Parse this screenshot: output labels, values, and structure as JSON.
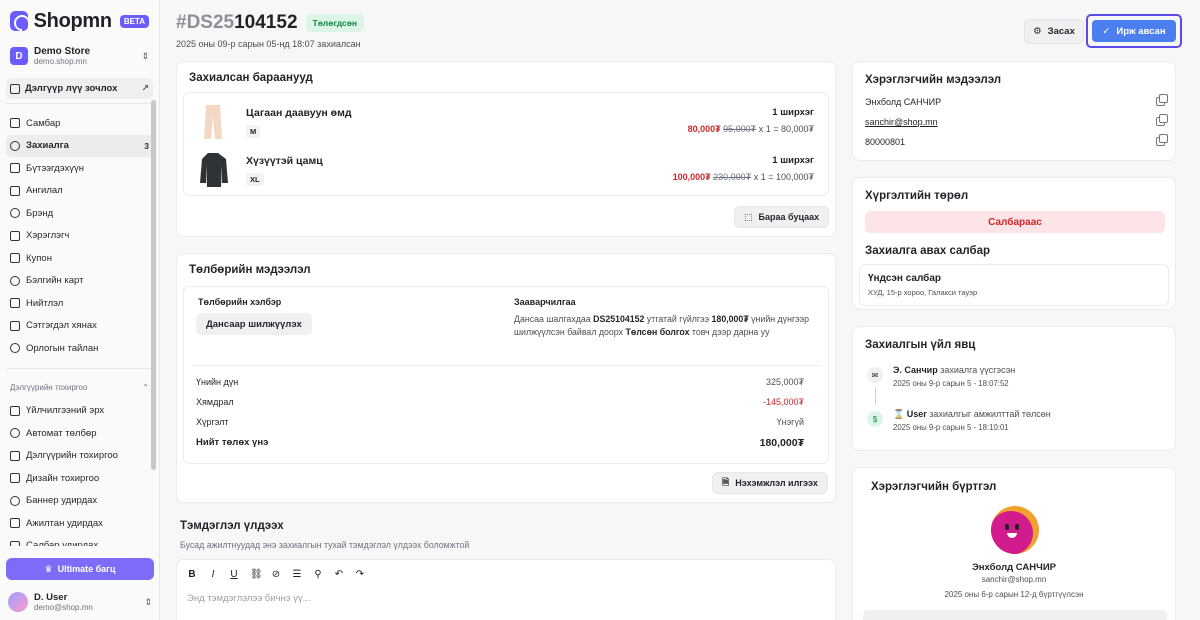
{
  "sidebar": {
    "logo_text": "Shopmn",
    "beta": "BETA",
    "store": {
      "initial": "D",
      "name": "Demo Store",
      "domain": "demo.shop.mn"
    },
    "visit_label": "Дэлгүүр лүү зочлох",
    "items": [
      {
        "label": "Самбар",
        "icon": "home-icon"
      },
      {
        "label": "Захиалга",
        "icon": "inbox-icon",
        "count": "3"
      },
      {
        "label": "Бүтээгдэхүүн",
        "icon": "package-icon"
      },
      {
        "label": "Ангилал",
        "icon": "category-icon"
      },
      {
        "label": "Брэнд",
        "icon": "tag-icon"
      },
      {
        "label": "Хэрэглэгч",
        "icon": "users-icon"
      },
      {
        "label": "Купон",
        "icon": "ticket-icon"
      },
      {
        "label": "Бэлгийн карт",
        "icon": "gift-card-icon"
      },
      {
        "label": "Нийтлэл",
        "icon": "article-icon"
      },
      {
        "label": "Сэтгэгдэл хянах",
        "icon": "comment-icon"
      },
      {
        "label": "Орлогын тайлан",
        "icon": "report-icon"
      }
    ],
    "section_label": "Дэлгүүрийн тохиргоо",
    "settings_items": [
      {
        "label": "Үйлчилгээний эрх",
        "icon": "license-icon"
      },
      {
        "label": "Автомат төлбөр",
        "icon": "autopay-icon"
      },
      {
        "label": "Дэлгүүрийн тохиргоо",
        "icon": "settings-icon"
      },
      {
        "label": "Дизайн тохиргоо",
        "icon": "brush-icon"
      },
      {
        "label": "Баннер удирдах",
        "icon": "banner-icon"
      },
      {
        "label": "Ажилтан удирдах",
        "icon": "staff-icon"
      },
      {
        "label": "Салбар удирдах",
        "icon": "branch-icon"
      }
    ],
    "ultimate_label": "Ultimate багц",
    "user": {
      "name": "D. User",
      "email": "demo@shop.mn"
    }
  },
  "header": {
    "hash": "#DS25",
    "order_rest": "104152",
    "status": "Төлөгдсөн",
    "date": "2025 оны 09-р сарын 05-нд 18:07 захиалсан",
    "edit_label": "Засах",
    "received_label": "Ирж авсан"
  },
  "products": {
    "title": "Захиалсан бараанууд",
    "items": [
      {
        "name": "Цагаан даавуун өмд",
        "variant": "M",
        "qty": "1 ширхэг",
        "sale": "80,000₮",
        "old": "95,000₮",
        "calc": "x 1 = 80,000₮"
      },
      {
        "name": "Хүзүүтэй цамц",
        "variant": "XL",
        "qty": "1 ширхэг",
        "sale": "100,000₮",
        "old": "230,000₮",
        "calc": "x 1 = 100,000₮"
      }
    ],
    "return_label": "Бараа буцаах"
  },
  "payment": {
    "title": "Төлбөрийн мэдээлэл",
    "method_label": "Төлбөрийн хэлбэр",
    "method": "Дансаар шилжүүлэх",
    "instr_label": "Зааварчилгаа",
    "instr_1": "Дансаа шалгахдаа ",
    "instr_code": "DS25104152",
    "instr_2": " утгатай гүйлгээ ",
    "instr_amount": "180,000₮",
    "instr_3": " үнийн дүнгээр шилжүүлсэн байвал доорх ",
    "instr_btn": "Төлсөн болгох",
    "instr_4": " товч дээр дарна уу",
    "rows": [
      {
        "label": "Үнийн дүн",
        "value": "325,000₮"
      },
      {
        "label": "Хямдрал",
        "value": "-145,000₮"
      },
      {
        "label": "Хүргэлт",
        "value": "Үнэгүй"
      }
    ],
    "total_label": "Нийт төлөх үнэ",
    "total_value": "180,000₮",
    "invoice_label": "Нэхэмжлэл илгээх"
  },
  "notes": {
    "title": "Тэмдэглэл үлдээх",
    "subtitle": "Бусад ажилтнуудад энэ захиалгын тухай тэмдэглэл үлдээх боломжтой",
    "placeholder": "Энд тэмдэглэлээ бичнэ үү..."
  },
  "customer": {
    "title": "Хэрэглэгчийн мэдээлэл",
    "name": "Энхболд САНЧИР",
    "email": "sanchir@shop.mn",
    "phone": "80000801"
  },
  "delivery": {
    "title": "Хүргэлтийн төрөл",
    "type": "Салбараас",
    "pickup_title": "Захиалга авах салбар",
    "branch_name": "Үндсэн салбар",
    "branch_addr": "ХУД, 15-р хороо, Галакси тауэр"
  },
  "timeline": {
    "title": "Захиалгын үйл явц",
    "items": [
      {
        "actor": "Э. Санчир",
        "action": " захиалга үүсгэсэн",
        "date": "2025 оны 9-р сарын 5 - 18:07:52"
      },
      {
        "actor": "User",
        "action": " захиалгыг амжилттай төлсөн",
        "date": "2025 оны 9-р сарын 5 - 18:10:01"
      }
    ]
  },
  "registration": {
    "title": "Хэрэглэгчийн бүртгэл",
    "name": "Энхболд САНЧИР",
    "email": "sanchir@shop.mn",
    "date": "2025 оны 6-р сарын 12-д бүртгүүлсэн"
  },
  "colors": {
    "accent": "#6a5cff",
    "primary_button": "#4b7ff0",
    "danger": "#d0262b",
    "success": "#118a44"
  }
}
